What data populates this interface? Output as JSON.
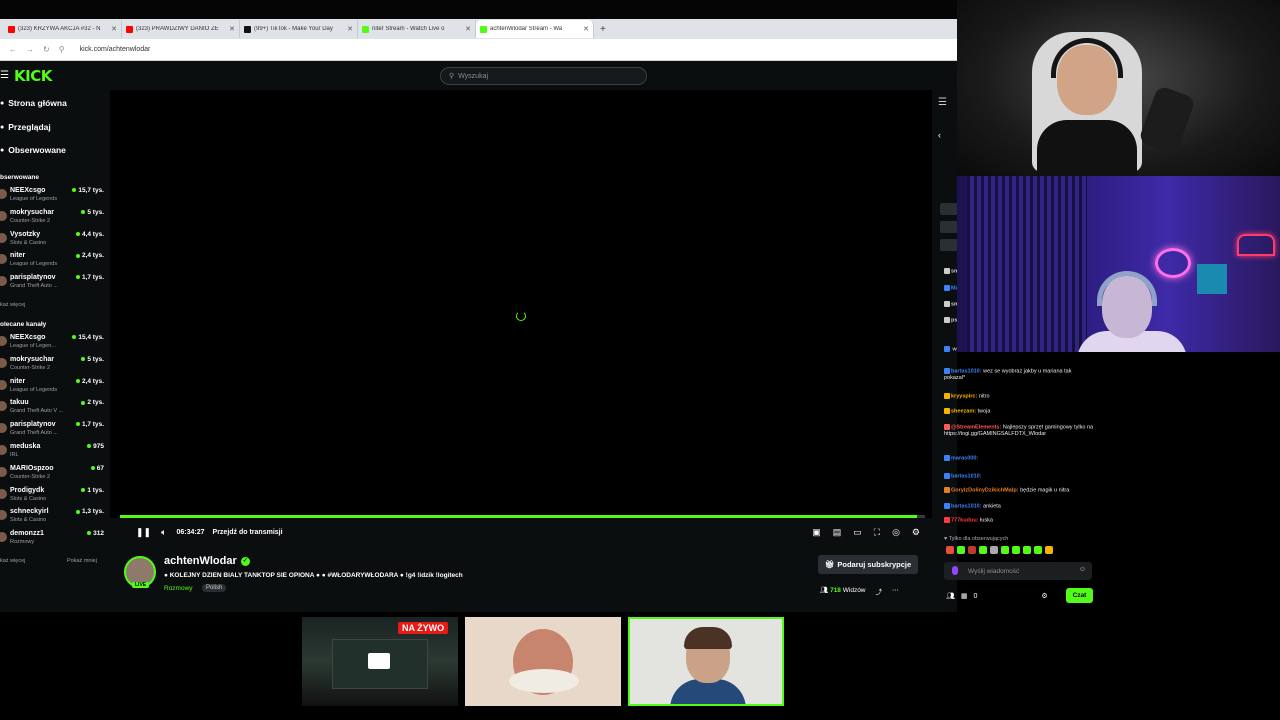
{
  "browser": {
    "tabs": [
      {
        "label": "(323) KRZYWA AKCJA #32 - N",
        "fav_color": "#ff0000",
        "active": false
      },
      {
        "label": "(323) PRAWDZIWY DANIO ZE",
        "fav_color": "#ff0000",
        "active": false
      },
      {
        "label": "(99+) TikTok - Make Your Day",
        "fav_color": "#111111",
        "active": false
      },
      {
        "label": "niter Stream - Watch Live o",
        "fav_color": "#53fc18",
        "active": false
      },
      {
        "label": "achtenWlodar Stream - Wa",
        "fav_color": "#53fc18",
        "active": true
      }
    ],
    "new_tab": "+",
    "url": "kick.com/achtenwlodar"
  },
  "kick": {
    "logo": "KICK",
    "search_placeholder": "Wyszukaj",
    "nav": [
      {
        "label": "Strona główna"
      },
      {
        "label": "Przeglądaj"
      },
      {
        "label": "Obserwowane"
      }
    ],
    "followed_title": "bserwowane",
    "followed": [
      {
        "name": "NEEXcsgo",
        "game": "League of Legends",
        "viewers": "15,7 tys."
      },
      {
        "name": "mokrysuchar",
        "game": "Counter-Strike 2",
        "viewers": "5 tys."
      },
      {
        "name": "Vysotzky",
        "game": "Slots & Casino",
        "viewers": "4,4 tys."
      },
      {
        "name": "niter",
        "game": "League of Legends",
        "viewers": "2,4 tys."
      },
      {
        "name": "parisplatynov",
        "game": "Grand Theft Auto ...",
        "viewers": "1,7 tys."
      }
    ],
    "show_more": "każ więcej",
    "recommended_title": "olecane kanały",
    "recommended": [
      {
        "name": "NEEXcsgo",
        "game": "League of Legen...",
        "viewers": "15,4 tys."
      },
      {
        "name": "mokrysuchar",
        "game": "Counter-Strike 2",
        "viewers": "5 tys."
      },
      {
        "name": "niter",
        "game": "League of Legends",
        "viewers": "2,4 tys."
      },
      {
        "name": "takuu",
        "game": "Grand Theft Auto V ...",
        "viewers": "2 tys."
      },
      {
        "name": "parisplatynov",
        "game": "Grand Theft Auto ...",
        "viewers": "1,7 tys."
      },
      {
        "name": "meduska",
        "game": "IRL",
        "viewers": "975"
      },
      {
        "name": "MARIOspzoo",
        "game": "Counter-Strike 2",
        "viewers": "67"
      },
      {
        "name": "Prodigydk",
        "game": "Slots & Casino",
        "viewers": "1 tys."
      },
      {
        "name": "schneckyirl",
        "game": "Slots & Casino",
        "viewers": "1,3 tys."
      },
      {
        "name": "demonzz1",
        "game": "Rozmowy",
        "viewers": "312"
      }
    ],
    "show_more_2": "każ więcej",
    "show_less": "Pokaż mniej",
    "player": {
      "time": "06:34:27",
      "jump_live": "Przejdź do transmisji",
      "progress": 0.99
    },
    "stream": {
      "streamer": "achtenWlodar",
      "live": "LIVE",
      "title": "● KOLEJNY DZIEN BIALY TANKTOP SIE OPIONA ● ● #WŁODARYWŁODARA ● !g4 !idzik !logitech",
      "category": "Rozmowy",
      "tag": "Polish",
      "subscribe": "Podaruj subskrypcje",
      "viewers": "718",
      "viewers_label": "Widzów"
    }
  },
  "chat": {
    "messages": [
      {
        "user": "smaj",
        "text": "",
        "color": "#cccccc"
      },
      {
        "user": "Mag",
        "text": "",
        "color": "#3b82f6"
      },
      {
        "user": "smaj",
        "text": "",
        "color": "#cccccc"
      },
      {
        "user": "psyt",
        "text": "",
        "color": "#cccccc"
      },
      {
        "user": "",
        "text": "wez se wyobraz jakby u mariana tak pokazal*",
        "color": "#3b82f6"
      },
      {
        "user": "bartas1010:",
        "text": "wez se wyobraz jakby u mariana tak pokazal*",
        "color": "#3b82f6"
      },
      {
        "user": "kryyspirc:",
        "text": "nitro",
        "color": "#f7b500"
      },
      {
        "user": "sheezam:",
        "text": "twoja",
        "color": "#f7b500"
      },
      {
        "user": "@StreamElements:",
        "text": "Najlepszy sprzęt gamingowy tylko na https://togi.gg/GAMINGSALFDTX_Wlodar",
        "color": "#ff5a5a"
      },
      {
        "user": "maras000:",
        "text": "",
        "color": "#3b82f6"
      },
      {
        "user": "bartas1010:",
        "text": "",
        "color": "#3b82f6"
      },
      {
        "user": "GoryIzDolinyDzikichMalp:",
        "text": "będzie magik u nitra",
        "color": "#e67e22"
      },
      {
        "user": "bartas1010:",
        "text": "ankieta",
        "color": "#3b82f6"
      },
      {
        "user": "777kuduu:",
        "text": "łuska",
        "color": "#ff3b3b"
      }
    ],
    "followers_only": "Tylko dla obserwujących",
    "input_placeholder": "Wyślij wiadomość",
    "points": "0",
    "send_label": "Czat"
  },
  "thumbnails": {
    "live_badge": "NA ŻYWO"
  },
  "colors": {
    "kick_green": "#53fc18",
    "background": "#0b0e0f"
  }
}
